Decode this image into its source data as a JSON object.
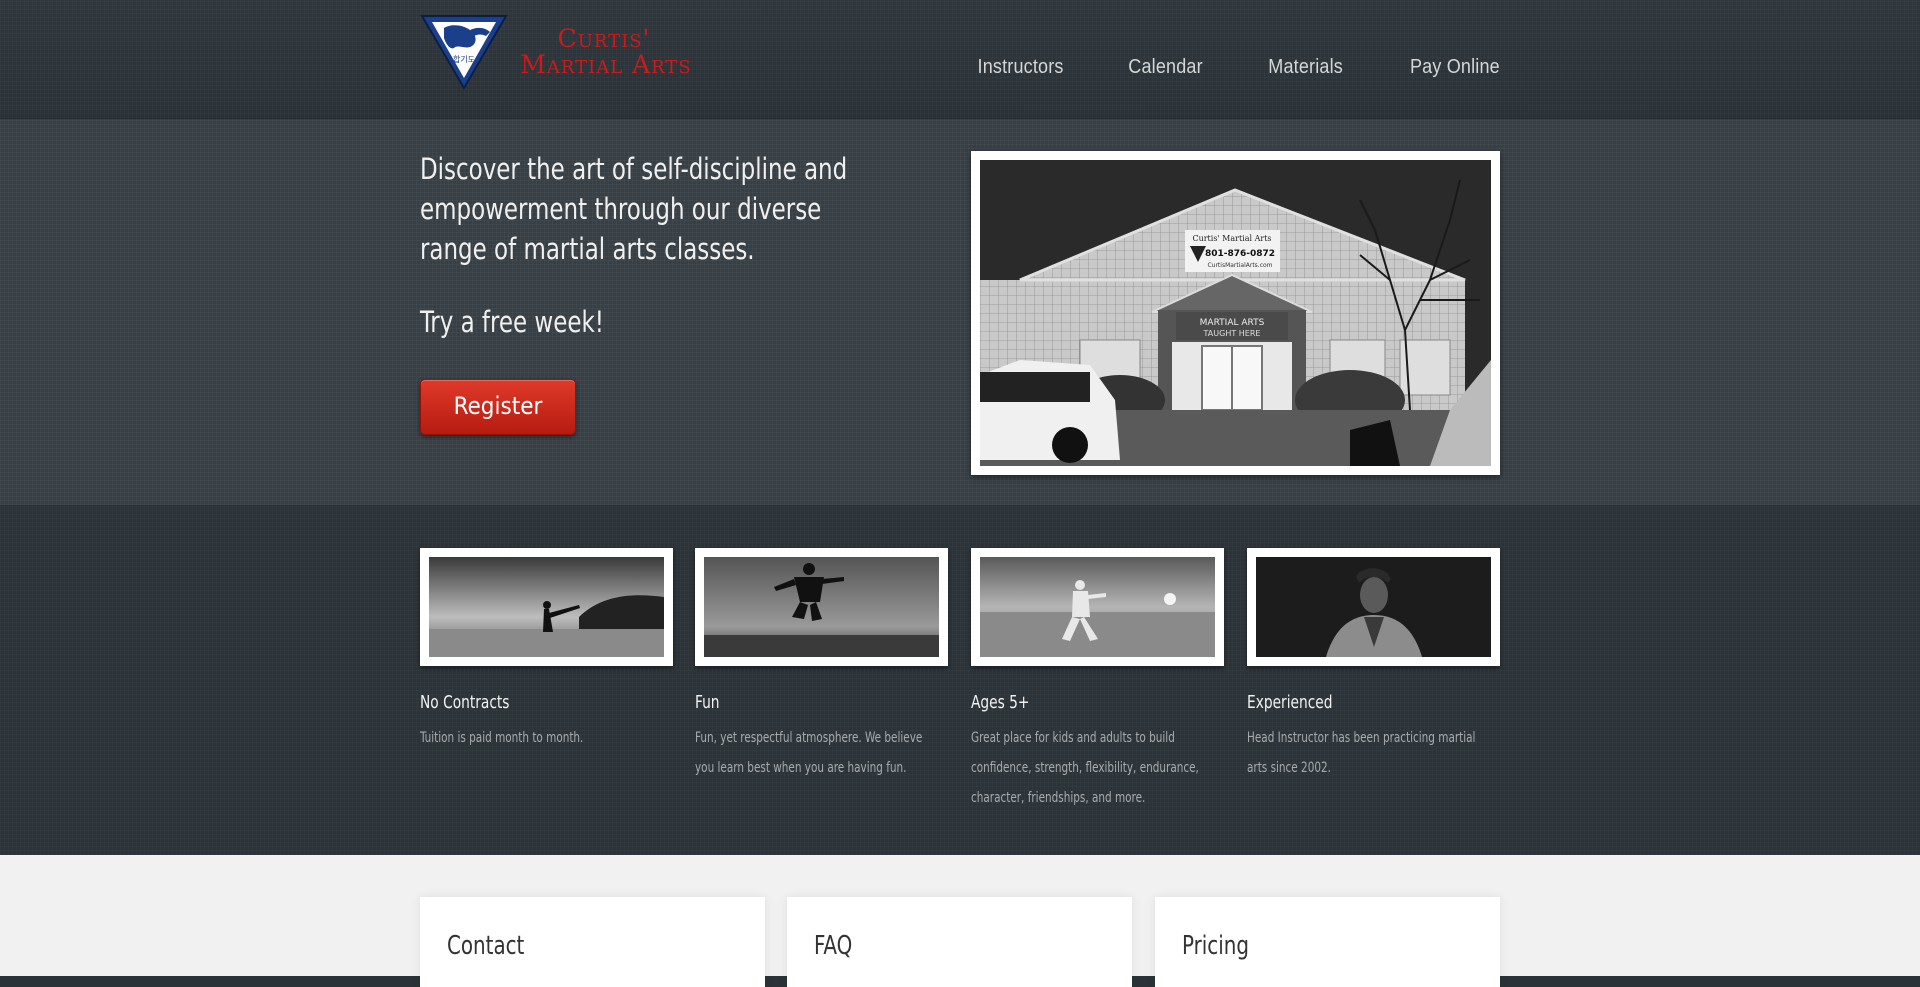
{
  "brand": {
    "name_line1": "Curtis'",
    "name_line2": "Martial Arts",
    "emblem_text": "합기도"
  },
  "nav": {
    "items": [
      "Instructors",
      "Calendar",
      "Materials",
      "Pay Online"
    ]
  },
  "hero": {
    "headline": "Discover the art of self-discipline and empowerment through our diverse range of martial arts classes.",
    "subheadline": "Try a free week!",
    "register_label": "Register",
    "photo": {
      "sign_line1": "Curtis' Martial Arts",
      "sign_phone": "801-876-0872",
      "sign_site": "CurtisMartialArts.com",
      "banner_line1": "MARTIAL ARTS",
      "banner_line2": "TAUGHT HERE"
    }
  },
  "features": [
    {
      "title": "No Contracts",
      "text": "Tuition is paid month to month."
    },
    {
      "title": "Fun",
      "text": "Fun, yet respectful atmosphere. We believe you learn best when you are having fun."
    },
    {
      "title": "Ages 5+",
      "text": "Great place for kids and adults to build confidence, strength, flexibility, endurance, character, friendships, and more."
    },
    {
      "title": "Experienced",
      "text": "Head Instructor has been practicing martial arts since 2002."
    }
  ],
  "cards": [
    "Contact",
    "FAQ",
    "Pricing"
  ],
  "colors": {
    "brand_red": "#c81c1c",
    "button_red": "#d02a1e",
    "dark_bg": "#2c3338",
    "hero_bg": "#384046",
    "light_bg": "#f1f1f1",
    "emblem_blue": "#1c3f8c"
  }
}
